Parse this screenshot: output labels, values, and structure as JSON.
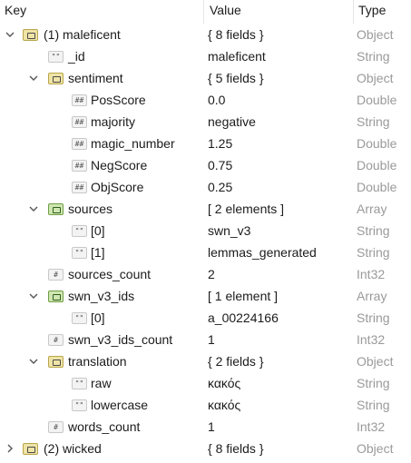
{
  "columns": {
    "key": "Key",
    "value": "Value",
    "type": "Type"
  },
  "rows": [
    {
      "key": "(1) maleficent",
      "value": "{ 8 fields }",
      "type": "Object",
      "icon": "object-icon",
      "expander": "expanded"
    },
    {
      "key": "_id",
      "value": "maleficent",
      "type": "String",
      "icon": "string-icon",
      "expander": "none"
    },
    {
      "key": "sentiment",
      "value": "{ 5 fields }",
      "type": "Object",
      "icon": "object-icon",
      "expander": "expanded"
    },
    {
      "key": "PosScore",
      "value": "0.0",
      "type": "Double",
      "icon": "number-icon",
      "expander": "none"
    },
    {
      "key": "majority",
      "value": "negative",
      "type": "String",
      "icon": "number-icon",
      "expander": "none"
    },
    {
      "key": "magic_number",
      "value": "1.25",
      "type": "Double",
      "icon": "number-icon",
      "expander": "none"
    },
    {
      "key": "NegScore",
      "value": "0.75",
      "type": "Double",
      "icon": "number-icon",
      "expander": "none"
    },
    {
      "key": "ObjScore",
      "value": "0.25",
      "type": "Double",
      "icon": "number-icon",
      "expander": "none"
    },
    {
      "key": "sources",
      "value": "[ 2 elements ]",
      "type": "Array",
      "icon": "array-icon",
      "expander": "expanded"
    },
    {
      "key": "[0]",
      "value": "swn_v3",
      "type": "String",
      "icon": "string-icon",
      "expander": "none"
    },
    {
      "key": "[1]",
      "value": "lemmas_generated",
      "type": "String",
      "icon": "string-icon",
      "expander": "none"
    },
    {
      "key": "sources_count",
      "value": "2",
      "type": "Int32",
      "icon": "int-icon",
      "expander": "none"
    },
    {
      "key": "swn_v3_ids",
      "value": "[ 1 element ]",
      "type": "Array",
      "icon": "array-icon",
      "expander": "expanded"
    },
    {
      "key": "[0]",
      "value": "a_00224166",
      "type": "String",
      "icon": "string-icon",
      "expander": "none"
    },
    {
      "key": "swn_v3_ids_count",
      "value": "1",
      "type": "Int32",
      "icon": "int-icon",
      "expander": "none"
    },
    {
      "key": "translation",
      "value": "{ 2 fields }",
      "type": "Object",
      "icon": "object-icon",
      "expander": "expanded"
    },
    {
      "key": "raw",
      "value": "κακός",
      "type": "String",
      "icon": "string-icon",
      "expander": "none"
    },
    {
      "key": "lowercase",
      "value": "κακός",
      "type": "String",
      "icon": "string-icon",
      "expander": "none"
    },
    {
      "key": "words_count",
      "value": "1",
      "type": "Int32",
      "icon": "int-icon",
      "expander": "none"
    },
    {
      "key": "(2) wicked",
      "value": "{ 8 fields }",
      "type": "Object",
      "icon": "object-icon",
      "expander": "collapsed"
    }
  ],
  "icon_glyphs": {
    "string": "\"\"",
    "number": "##",
    "int": "#"
  }
}
